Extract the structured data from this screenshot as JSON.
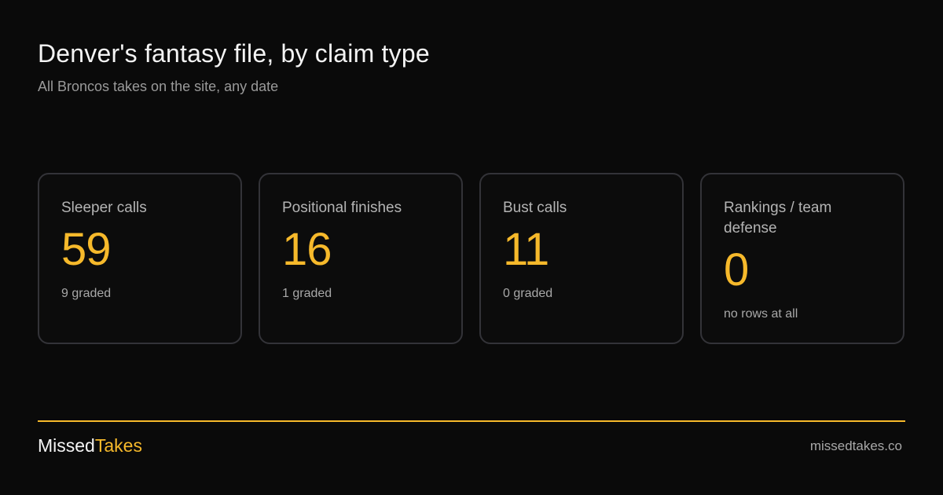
{
  "header": {
    "title": "Denver's fantasy file, by claim type",
    "subtitle": "All Broncos takes on the site, any date"
  },
  "cards": [
    {
      "label": "Sleeper calls",
      "value": "59",
      "note": "9 graded"
    },
    {
      "label": "Positional finishes",
      "value": "16",
      "note": "1 graded"
    },
    {
      "label": "Bust calls",
      "value": "11",
      "note": "0 graded"
    },
    {
      "label": "Rankings / team defense",
      "value": "0",
      "note": "no rows at all"
    }
  ],
  "footer": {
    "brand_part1": "Missed",
    "brand_part2": "Takes",
    "url": "missedtakes.co"
  },
  "colors": {
    "background": "#0a0a0a",
    "accent": "#f6b92b",
    "card_border": "#333338"
  }
}
